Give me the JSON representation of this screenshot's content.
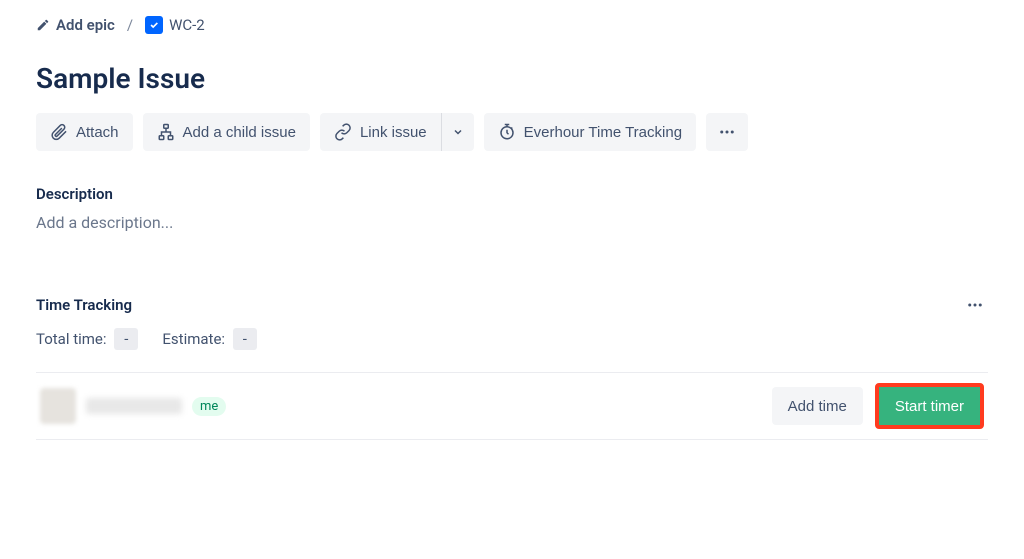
{
  "breadcrumb": {
    "add_epic": "Add epic",
    "separator": "/",
    "issue_key": "WC-2"
  },
  "issue": {
    "title": "Sample Issue"
  },
  "toolbar": {
    "attach": "Attach",
    "add_child": "Add a child issue",
    "link_issue": "Link issue",
    "everhour": "Everhour Time Tracking"
  },
  "description": {
    "label": "Description",
    "placeholder": "Add a description..."
  },
  "time_tracking": {
    "label": "Time Tracking",
    "total_label": "Total time:",
    "total_value": "-",
    "estimate_label": "Estimate:",
    "estimate_value": "-",
    "me_badge": "me",
    "add_time": "Add time",
    "start_timer": "Start timer"
  }
}
